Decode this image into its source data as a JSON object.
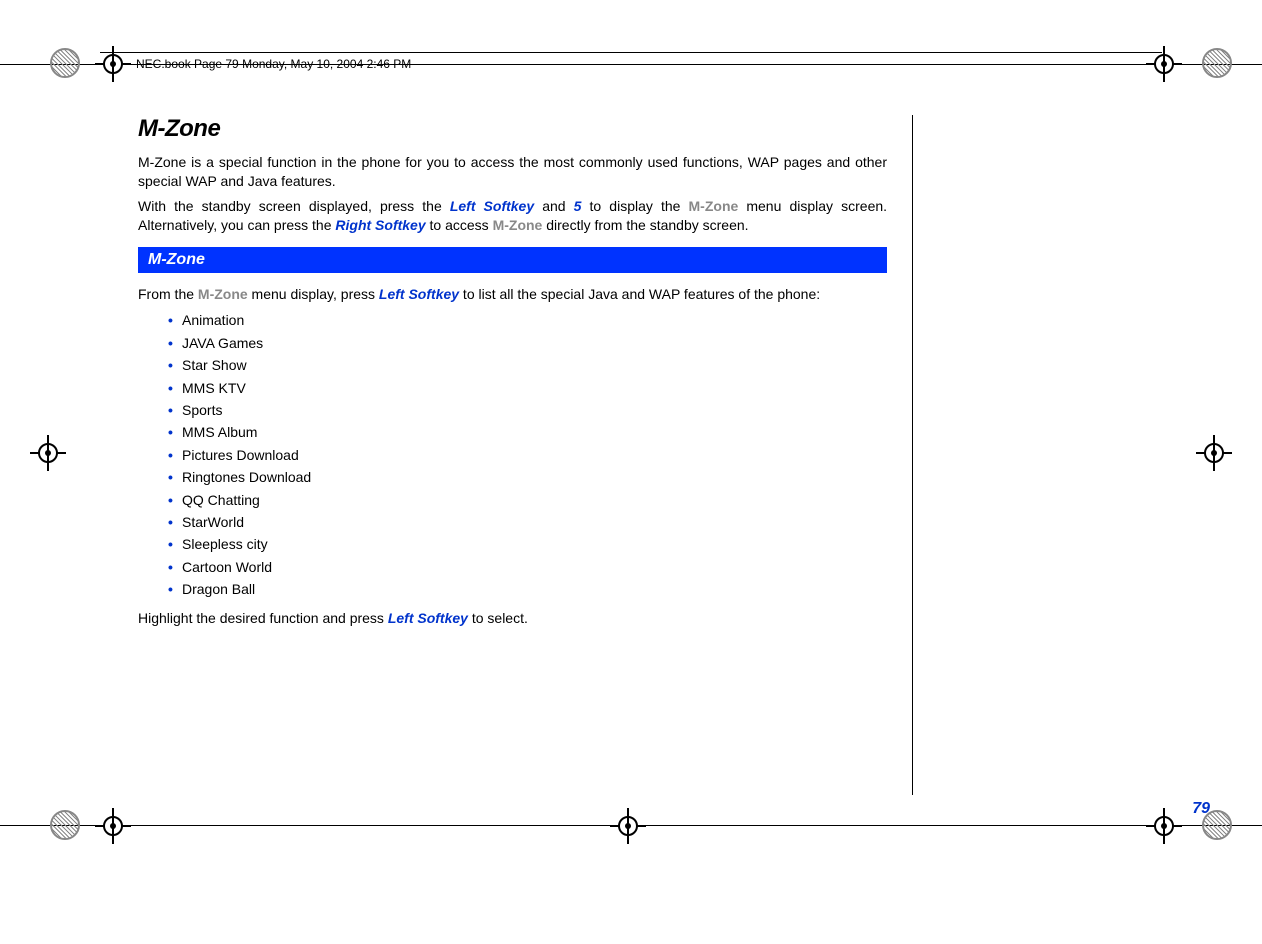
{
  "header_caption": "NEC.book  Page 79  Monday, May 10, 2004  2:46 PM",
  "page_number": "79",
  "title": "M-Zone",
  "intro_paragraph": "M-Zone is a special function in the phone for you to access the most commonly used functions, WAP pages and other special WAP and Java features.",
  "p2_a": "With the standby screen displayed, press the ",
  "p2_left_softkey": "Left Softkey",
  "p2_b": " and ",
  "p2_five": "5",
  "p2_c": " to display the ",
  "p2_mzone1": "M-Zone",
  "p2_d": " menu display screen. Alternatively, you can press the ",
  "p2_right_softkey": "Right Softkey",
  "p2_e": " to access ",
  "p2_mzone2": "M-Zone",
  "p2_f": " directly from the standby screen.",
  "section_header": "M-Zone",
  "p3_a": "From the ",
  "p3_mzone": "M-Zone",
  "p3_b": " menu display, press ",
  "p3_left_softkey": "Left Softkey",
  "p3_c": " to list all the special Java and WAP features of the phone:",
  "bullets": [
    "Animation",
    "JAVA Games",
    "Star Show",
    "MMS KTV",
    "Sports",
    "MMS Album",
    "Pictures Download",
    "Ringtones Download",
    "QQ Chatting",
    "StarWorld",
    "Sleepless city",
    "Cartoon World",
    "Dragon Ball"
  ],
  "p4_a": "Highlight the desired function and press ",
  "p4_left_softkey": "Left Softkey",
  "p4_b": " to select."
}
